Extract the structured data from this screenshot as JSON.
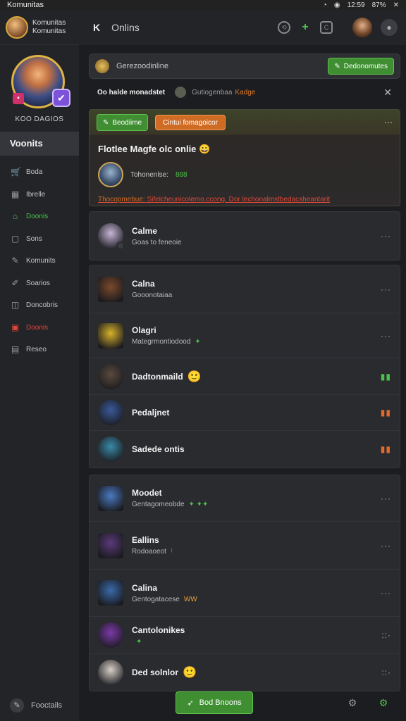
{
  "status_bar": {
    "title": "Komunitas",
    "time": "12:59",
    "battery": "87%"
  },
  "sidebar": {
    "profile_name": "Komunitas",
    "profile_sub": "Komunitas",
    "user_name": "KOO DAGIOS",
    "heading": "Voonits",
    "items": [
      {
        "label": "Boda",
        "icon": "cart-icon",
        "state": "normal"
      },
      {
        "label": "Ibrelle",
        "icon": "calendar-icon",
        "state": "normal"
      },
      {
        "label": "Doonis",
        "icon": "community-icon",
        "state": "active"
      },
      {
        "label": "Sons",
        "icon": "square-icon",
        "state": "normal"
      },
      {
        "label": "Komunits",
        "icon": "pin-icon",
        "state": "normal"
      },
      {
        "label": "Soarios",
        "icon": "tool-icon",
        "state": "normal"
      },
      {
        "label": "Doncobris",
        "icon": "photo-icon",
        "state": "normal"
      },
      {
        "label": "Doonis",
        "icon": "alert-icon",
        "state": "alert"
      },
      {
        "label": "Reseo",
        "icon": "list-icon",
        "state": "normal"
      }
    ],
    "footer_label": "Fooctails"
  },
  "header": {
    "back": "K",
    "title": "Onlins"
  },
  "search": {
    "text": "Gerezoodinline",
    "button": "Dedonomutes"
  },
  "notice": {
    "title": "Oo halde monadstet",
    "handle": "Gutiogenbaa",
    "tag": "Kadge"
  },
  "highlight": {
    "btn_green": "Beodiime",
    "btn_orange": "Cintui fomagoicor",
    "title": "Flotlee Magfe olc onlie",
    "title_emoji": "😀",
    "row_text": "Tohonenlse:",
    "row_points": "888",
    "link_prefix": "Thocopmebue:",
    "link_text": "Sifelcheunicolemo.ccong. Dor lechonalmstbedacsheantarit"
  },
  "groups": [
    [
      {
        "name": "Calme",
        "sub": "Goas to feneoie",
        "tag": "",
        "emoji": "",
        "menu": "···",
        "menu_color": "normal",
        "avatar_color": "#c7b6d8",
        "square": false
      }
    ],
    [
      {
        "name": "Calna",
        "sub": "Gooonotaiaa",
        "tag": "",
        "emoji": "",
        "menu": "···",
        "menu_color": "normal",
        "avatar_color": "#7a4a2c",
        "square": true
      },
      {
        "name": "Olagri",
        "sub": "Mategrmontiodood",
        "tag": "✦",
        "emoji": "",
        "menu": "···",
        "menu_color": "normal",
        "avatar_color": "#d8b22a",
        "square": true
      },
      {
        "name": "Dadtonmaild",
        "sub": "",
        "tag": "",
        "emoji": "🙂",
        "menu": "▮▮",
        "menu_color": "green",
        "avatar_color": "#5a4a3e",
        "square": false
      },
      {
        "name": "Pedaljnet",
        "sub": "",
        "tag": "",
        "emoji": "",
        "menu": "▮▮",
        "menu_color": "orange",
        "avatar_color": "#3a5a9a",
        "square": false
      },
      {
        "name": "Sadede ontis",
        "sub": "",
        "tag": "",
        "emoji": "",
        "menu": "▮▮",
        "menu_color": "orange",
        "avatar_color": "#3a8aa8",
        "square": false
      }
    ],
    [
      {
        "name": "Moodet",
        "sub": "Gentagomeobde",
        "tag": "✦ ✦✦",
        "emoji": "",
        "menu": "···",
        "menu_color": "normal",
        "avatar_color": "#4a7ac2",
        "square": true
      },
      {
        "name": "Eallins",
        "sub": "Rodoaoeot",
        "tag": "!",
        "emoji": "",
        "menu": "···",
        "menu_color": "normal",
        "avatar_color": "#5a3a7a",
        "square": true
      },
      {
        "name": "Calina",
        "sub": "Gentogatacese",
        "tag": "WW",
        "emoji": "",
        "menu": "···",
        "menu_color": "normal",
        "avatar_color": "#3a6aaa",
        "square": true
      },
      {
        "name": "Cantolonikes",
        "sub": "",
        "tag": "✦",
        "emoji": "",
        "menu": "::·",
        "menu_color": "normal",
        "avatar_color": "#7a3aa8",
        "square": false
      },
      {
        "name": "Ded solnlor",
        "sub": "",
        "tag": "",
        "emoji": "🙂",
        "menu": "::·",
        "menu_color": "normal",
        "avatar_color": "#d8d0c8",
        "square": false
      }
    ]
  ],
  "bottom": {
    "button": "Bod Bnoons"
  }
}
